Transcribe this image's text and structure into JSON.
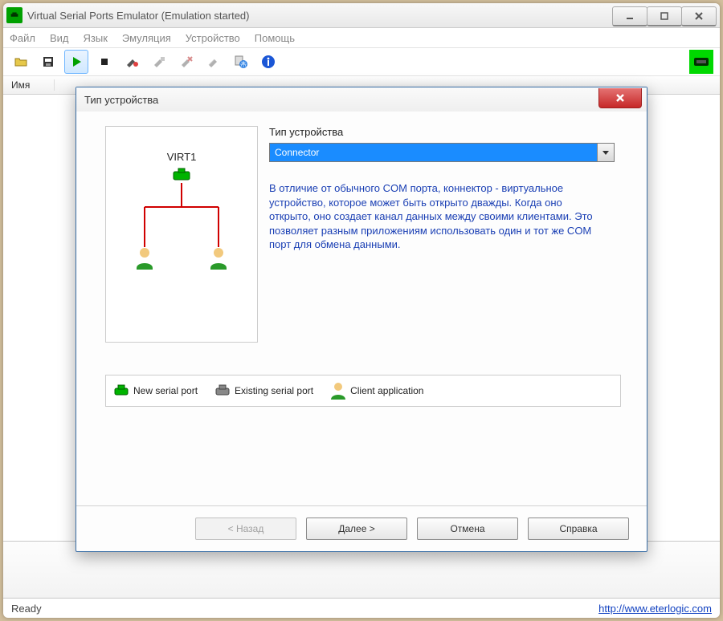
{
  "window": {
    "title": "Virtual Serial Ports Emulator (Emulation started)"
  },
  "menu": {
    "file": "Файл",
    "view": "Вид",
    "lang": "Язык",
    "emulation": "Эмуляция",
    "device": "Устройство",
    "help": "Помощь"
  },
  "list": {
    "col_name": "Имя"
  },
  "status": {
    "text": "Ready",
    "link": "http://www.eterlogic.com"
  },
  "dialog": {
    "title": "Тип устройства",
    "field_label": "Тип устройства",
    "combo_value": "Connector",
    "description": "В отличие от обычного COM порта, коннектор - виртуальное устройство, которое может быть открыто дважды. Когда оно открыто, оно создает канал данных между своими клиентами. Это позволяет разным приложениям использовать один и тот же COM порт для обмена данными.",
    "diagram_label": "VIRT1",
    "legend": {
      "new_port": "New serial port",
      "existing_port": "Existing serial port",
      "client_app": "Client application"
    },
    "buttons": {
      "back": "< Назад",
      "next": "Далее >",
      "cancel": "Отмена",
      "help": "Справка"
    }
  }
}
